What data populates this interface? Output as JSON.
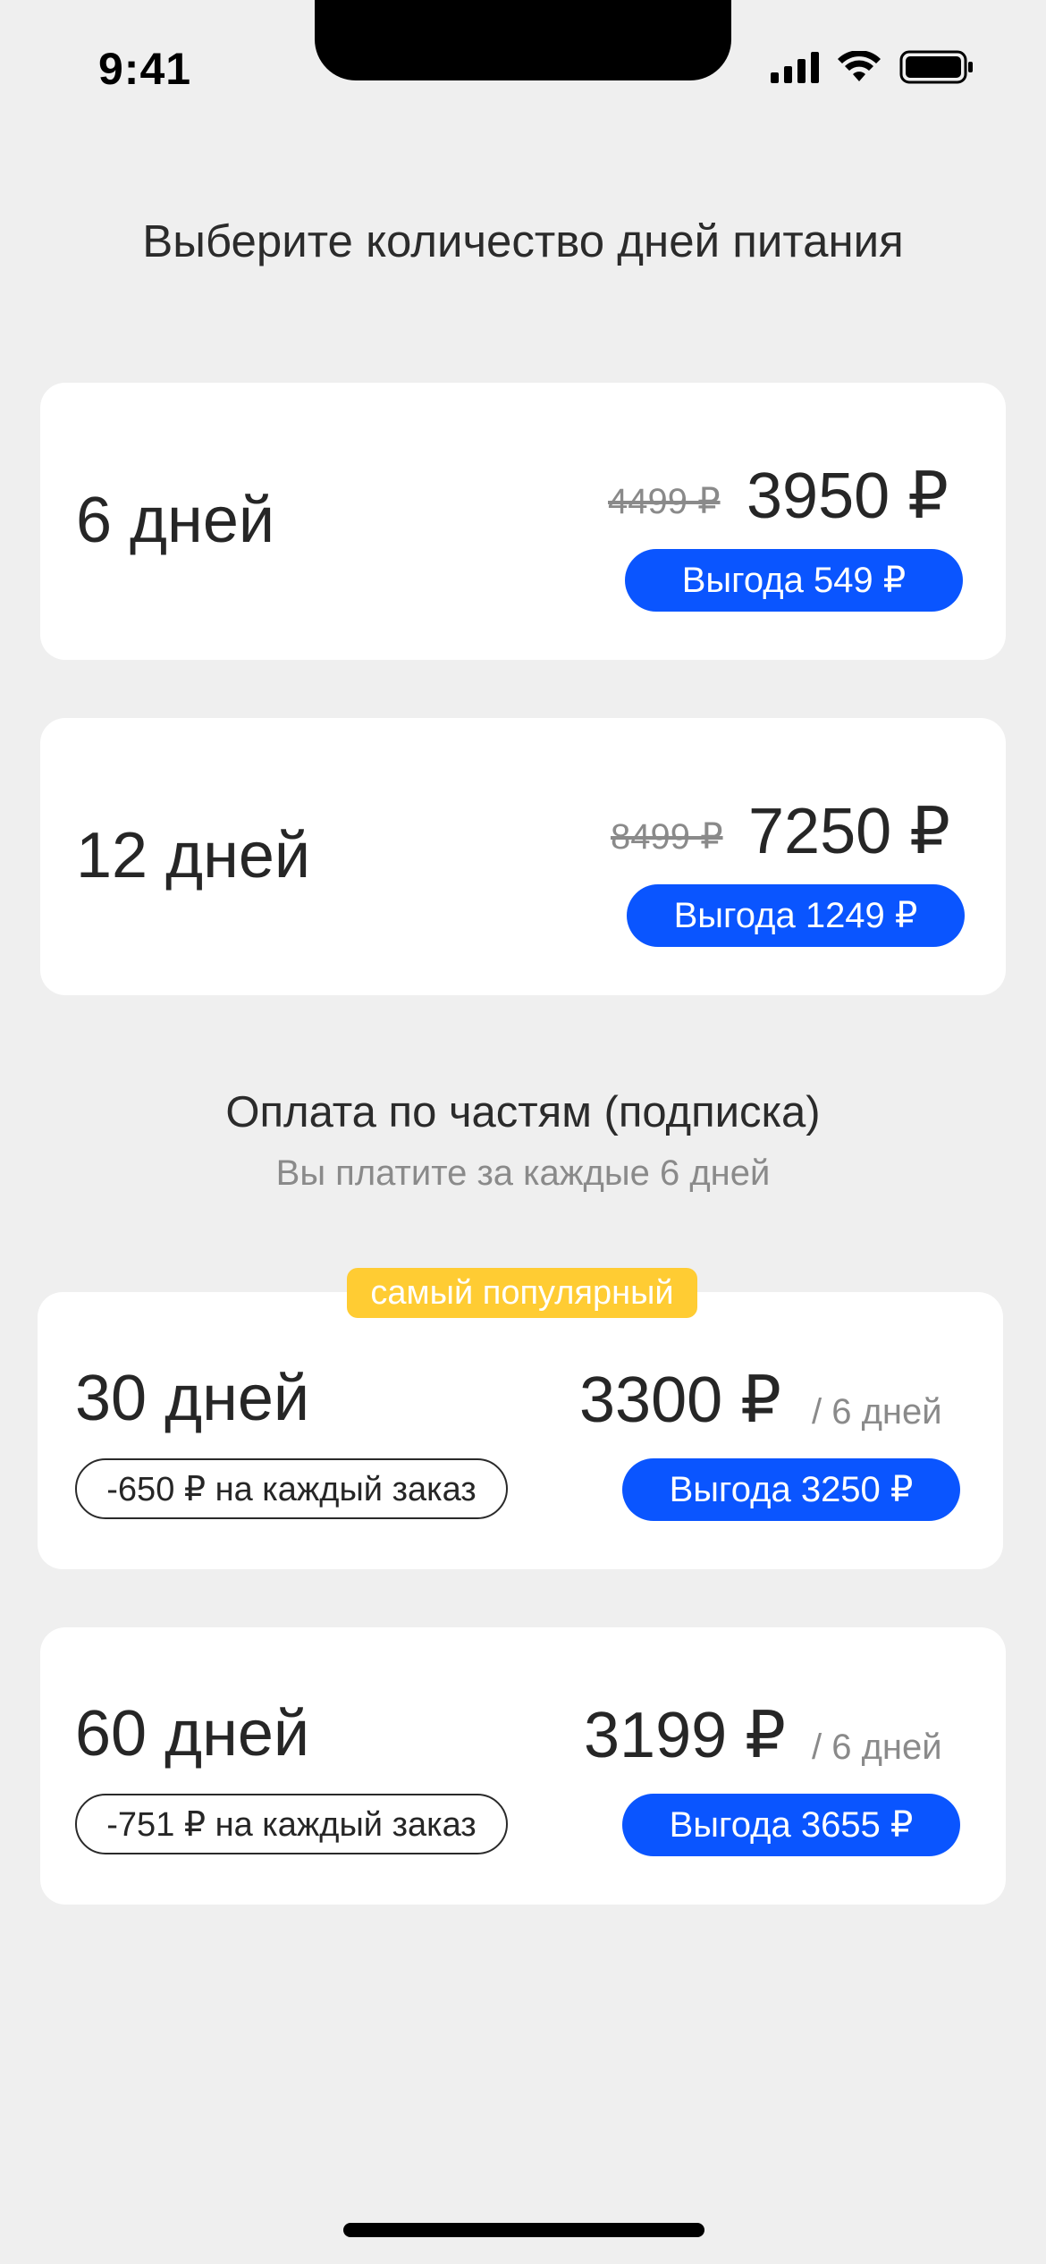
{
  "status_bar": {
    "time": "9:41"
  },
  "page_title": "Выберите количество дней питания",
  "plans": [
    {
      "days": "6 дней",
      "old_price": "4499 ₽",
      "price": "3950 ₽",
      "benefit": "Выгода 549 ₽"
    },
    {
      "days": "12 дней",
      "old_price": "8499 ₽",
      "price": "7250 ₽",
      "benefit": "Выгода 1249 ₽"
    }
  ],
  "subscription": {
    "title": "Оплата по частям (подписка)",
    "subtitle": "Вы платите за каждые 6 дней",
    "popular_badge": "самый популярный",
    "plans": [
      {
        "days": "30 дней",
        "price": "3300 ₽",
        "per": "/ 6 дней",
        "discount": "-650 ₽ на каждый заказ",
        "benefit": "Выгода 3250 ₽"
      },
      {
        "days": "60 дней",
        "price": "3199 ₽",
        "per": "/ 6 дней",
        "discount": "-751 ₽ на каждый заказ",
        "benefit": "Выгода 3655 ₽"
      }
    ]
  },
  "colors": {
    "accent": "#0a55ff",
    "badge": "#ffcc33",
    "background": "#efefef"
  }
}
